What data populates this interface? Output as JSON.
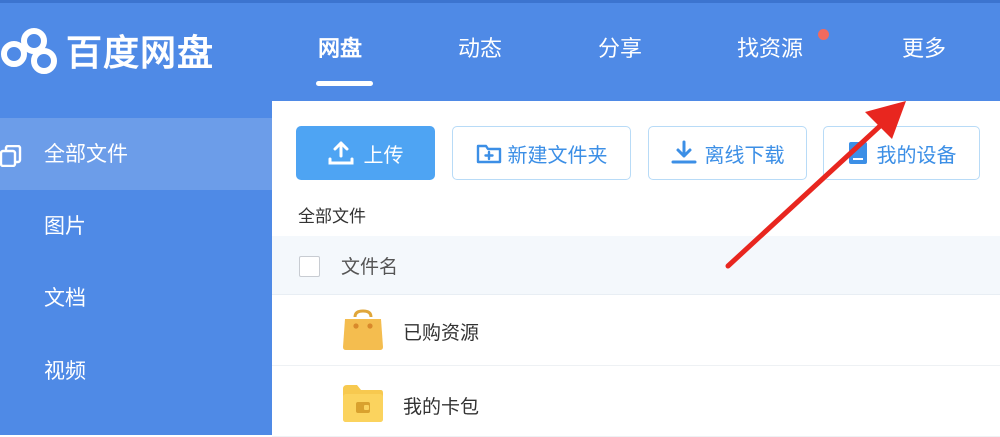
{
  "app": {
    "brand": "百度网盘"
  },
  "nav": {
    "items": [
      {
        "label": "网盘"
      },
      {
        "label": "动态"
      },
      {
        "label": "分享"
      },
      {
        "label": "找资源"
      },
      {
        "label": "更多"
      }
    ]
  },
  "sidebar": {
    "items": [
      {
        "label": "全部文件"
      },
      {
        "label": "图片"
      },
      {
        "label": "文档"
      },
      {
        "label": "视频"
      }
    ]
  },
  "toolbar": {
    "upload": "上传",
    "new_folder": "新建文件夹",
    "offline_download": "离线下载",
    "my_devices": "我的设备"
  },
  "breadcrumb": "全部文件",
  "table": {
    "column_name": "文件名",
    "rows": [
      {
        "name": "已购资源",
        "icon": "shopping-bag-icon"
      },
      {
        "name": "我的卡包",
        "icon": "wallet-folder-icon"
      }
    ]
  },
  "colors": {
    "brand_blue": "#4f8ae6",
    "primary_button": "#4ea4f3",
    "notification_dot": "#f06a5e",
    "annotation_arrow": "#e8261f"
  }
}
